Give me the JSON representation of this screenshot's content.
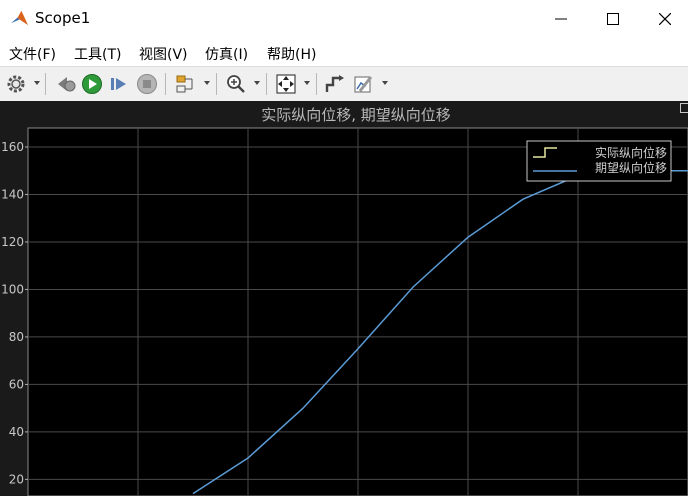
{
  "window": {
    "title": "Scope1"
  },
  "menu": {
    "items": [
      "文件(F)",
      "工具(T)",
      "视图(V)",
      "仿真(I)",
      "帮助(H)"
    ]
  },
  "toolbar": {
    "icons": [
      "gear-icon",
      "step-back-icon",
      "run-icon",
      "step-forward-icon",
      "stop-icon",
      "highlight-block-icon",
      "zoom-icon",
      "fit-to-view-icon",
      "cursor-measure-icon",
      "style-edit-icon"
    ]
  },
  "plot": {
    "title": "实际纵向位移, 期望纵向位移"
  },
  "chart_data": {
    "type": "line",
    "title": "实际纵向位移, 期望纵向位移",
    "xlabel": "",
    "ylabel": "",
    "ylim": [
      13,
      168
    ],
    "y_ticks": [
      20,
      40,
      60,
      80,
      100,
      120,
      140,
      160
    ],
    "x_range": [
      0,
      6
    ],
    "grid": true,
    "legend_position": "top-right",
    "colors": {
      "background": "#000000",
      "grid": "#4a4a4a",
      "series_actual": "#e6e6a0",
      "series_desired": "#5b9bd5"
    },
    "series": [
      {
        "name": "实际纵向位移",
        "x": [],
        "y": []
      },
      {
        "name": "期望纵向位移",
        "x": [
          1.5,
          2.0,
          2.5,
          3.0,
          3.5,
          4.0,
          4.5,
          5.0,
          5.5,
          6.0
        ],
        "y": [
          14,
          29,
          50,
          75,
          101,
          122,
          138,
          148,
          150,
          150
        ]
      }
    ]
  }
}
